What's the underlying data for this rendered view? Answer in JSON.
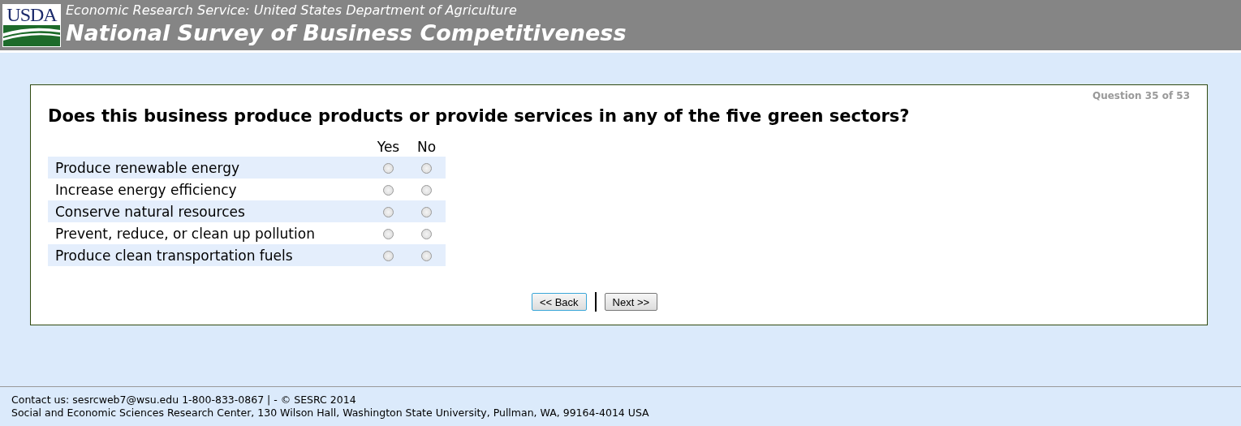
{
  "header": {
    "logo": "USDA",
    "agency": "Economic Research Service: United States Department of Agriculture",
    "title": "National Survey of Business Competitiveness"
  },
  "question": {
    "progress": "Question 35 of 53",
    "text": "Does this business produce products or provide services in any of the five green sectors?",
    "columns": [
      "Yes",
      "No"
    ],
    "rows": [
      {
        "label": "Produce renewable energy",
        "choices": [
          {
            "selected": false
          },
          {
            "selected": false
          }
        ]
      },
      {
        "label": "Increase energy efficiency",
        "choices": [
          {
            "selected": false
          },
          {
            "selected": false
          }
        ]
      },
      {
        "label": "Conserve natural resources",
        "choices": [
          {
            "selected": false
          },
          {
            "selected": false
          }
        ]
      },
      {
        "label": "Prevent, reduce, or clean up pollution",
        "choices": [
          {
            "selected": false
          },
          {
            "selected": false
          }
        ]
      },
      {
        "label": "Produce clean transportation fuels",
        "choices": [
          {
            "selected": false
          },
          {
            "selected": false
          }
        ]
      }
    ]
  },
  "nav": {
    "back": "<< Back",
    "next": "Next >>"
  },
  "footer": {
    "contact": "Contact us: sesrcweb7@wsu.edu 1-800-833-0867 | - © SESRC 2014",
    "address": "Social and Economic Sciences Research Center, 130 Wilson Hall, Washington State University, Pullman, WA, 99164-4014 USA"
  }
}
